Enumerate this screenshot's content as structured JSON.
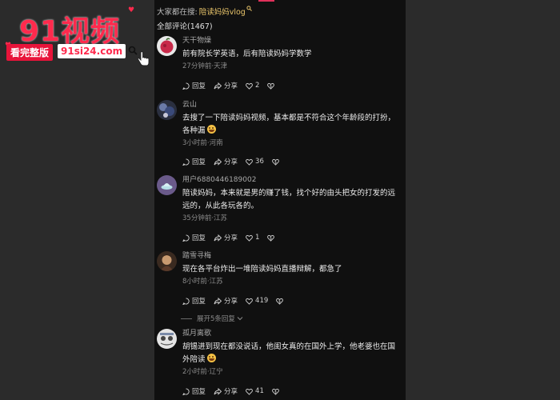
{
  "watermark": {
    "logo": "91视频",
    "button_label": "看完整版",
    "url": "91si24.com",
    "brand_color": "#ff2a4d"
  },
  "header": {
    "search_prefix": "大家都在搜:",
    "search_term": "陪读妈妈vlog",
    "all_comments": "全部评论(1467)"
  },
  "actions_labels": {
    "reply": "回复",
    "share": "分享"
  },
  "comments": [
    {
      "username": "天干物燥",
      "content": "前有院长学英语，后有陪读妈妈学数学",
      "meta": "27分钟前·天津",
      "likes": "2",
      "avatar_color": "#c82a4a"
    },
    {
      "username": "云山",
      "content": "去搜了一下陪读妈妈视频，基本都是不符合这个年龄段的打扮，各种漏",
      "meta": "3小时前·河南",
      "likes": "36",
      "avatar_color": "#3a4a7a"
    },
    {
      "username": "用户6880446189002",
      "content": "陪读妈妈，本来就是男的赚了钱，找个好的由头把女的打发的远远的，从此各玩各的。",
      "meta": "35分钟前·江苏",
      "likes": "1",
      "avatar_color": "#6a5a8a"
    },
    {
      "username": "踏雪寻梅",
      "content": "现在各平台炸出一堆陪读妈妈直播辩解，都急了",
      "meta": "8小时前·江苏",
      "likes": "419",
      "avatar_color": "#5a3a2a"
    },
    {
      "username": "孤月离歌",
      "content": "胡锡进到现在都没说话，他闺女真的在国外上学，他老婆也在国外陪读",
      "meta": "2小时前·辽宁",
      "likes": "41",
      "avatar_color": "#d8d8d8"
    }
  ],
  "expand_replies": "展开5条回复",
  "icons": [
    "reply-icon",
    "share-icon",
    "like-heart-icon",
    "dislike-heart-icon",
    "search-icon",
    "pointer-hand-icon"
  ]
}
